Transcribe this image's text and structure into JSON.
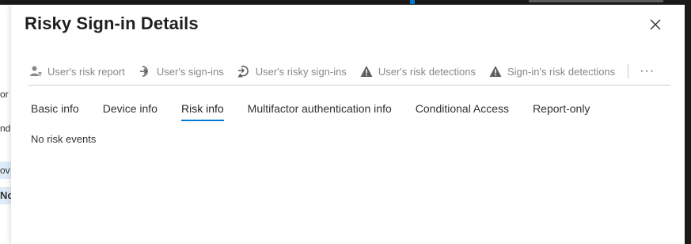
{
  "panel": {
    "title": "Risky Sign-in Details"
  },
  "toolbar": {
    "items": [
      {
        "label": "User's risk report",
        "icon": "user-risk-icon"
      },
      {
        "label": "User's sign-ins",
        "icon": "sign-in-arrow-icon"
      },
      {
        "label": "User's risky sign-ins",
        "icon": "risky-sign-in-icon"
      },
      {
        "label": "User's risk detections",
        "icon": "warning-icon"
      },
      {
        "label": "Sign-in's risk detections",
        "icon": "warning-icon"
      }
    ],
    "more_label": "···"
  },
  "tabs": [
    {
      "label": "Basic info",
      "active": false
    },
    {
      "label": "Device info",
      "active": false
    },
    {
      "label": "Risk info",
      "active": true
    },
    {
      "label": "Multifactor authentication info",
      "active": false
    },
    {
      "label": "Conditional Access",
      "active": false
    },
    {
      "label": "Report-only",
      "active": false
    }
  ],
  "content": {
    "message": "No risk events"
  },
  "background": {
    "fragments": [
      "or",
      "nd",
      "ov",
      "No"
    ]
  },
  "colors": {
    "accent": "#0078d4",
    "disabled_text": "#8a8886",
    "title": "#201f1e",
    "chrome_dark": "#1b1a19"
  }
}
